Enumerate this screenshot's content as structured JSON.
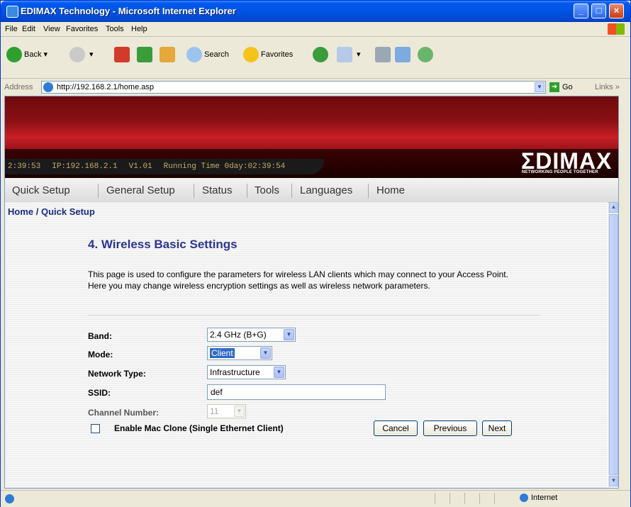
{
  "window": {
    "title": "EDIMAX Technology - Microsoft Internet Explorer",
    "minimize": "_",
    "maximize": "□",
    "close": "×"
  },
  "menubar": {
    "items": [
      "File",
      "Edit",
      "View",
      "Favorites",
      "Tools",
      "Help"
    ]
  },
  "toolbar": {
    "back": "Back",
    "search": "Search",
    "favorites": "Favorites"
  },
  "address": {
    "label": "Address",
    "url": "http://192.168.2.1/home.asp",
    "go": "Go",
    "links": "Links"
  },
  "router": {
    "status": {
      "time": "2:39:53",
      "ip": "IP:192.168.2.1",
      "version": "V1.01",
      "running": "Running Time 0day:02:39:54"
    },
    "logo": "ΣDIMAX",
    "logo_sub": "NETWORKING PEOPLE TOGETHER",
    "nav": [
      "Quick Setup",
      "General Setup",
      "Status",
      "Tools",
      "Languages",
      "Home"
    ]
  },
  "page": {
    "breadcrumb": "Home / Quick Setup",
    "title": "4. Wireless Basic Settings",
    "description": "This page is used to configure the parameters for wireless LAN clients which may connect to your Access Point. Here you may change wireless encryption settings as well as wireless network parameters."
  },
  "form": {
    "band_label": "Band:",
    "band_value": "2.4 GHz (B+G)",
    "mode_label": "Mode:",
    "mode_value": "Client",
    "network_type_label": "Network Type:",
    "network_type_value": "Infrastructure",
    "ssid_label": "SSID:",
    "ssid_value": "def",
    "channel_label": "Channel Number:",
    "channel_value": "11",
    "mac_clone_label": "Enable Mac Clone (Single Ethernet Client)",
    "mac_clone_checked": false,
    "cancel": "Cancel",
    "previous": "Previous",
    "next": "Next"
  },
  "statusbar": {
    "zone": "Internet"
  }
}
